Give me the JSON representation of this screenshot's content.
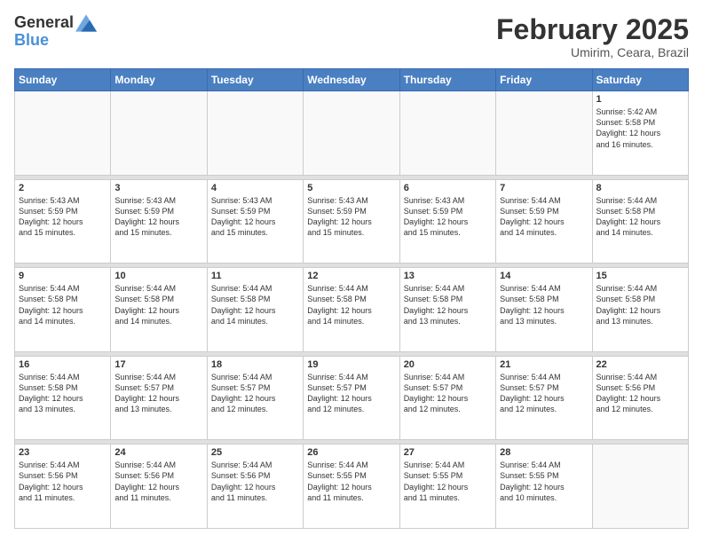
{
  "header": {
    "logo": {
      "text_general": "General",
      "text_blue": "Blue"
    },
    "title": "February 2025",
    "subtitle": "Umirim, Ceara, Brazil"
  },
  "days_of_week": [
    "Sunday",
    "Monday",
    "Tuesday",
    "Wednesday",
    "Thursday",
    "Friday",
    "Saturday"
  ],
  "weeks": [
    [
      {
        "day": "",
        "info": ""
      },
      {
        "day": "",
        "info": ""
      },
      {
        "day": "",
        "info": ""
      },
      {
        "day": "",
        "info": ""
      },
      {
        "day": "",
        "info": ""
      },
      {
        "day": "",
        "info": ""
      },
      {
        "day": "1",
        "info": "Sunrise: 5:42 AM\nSunset: 5:58 PM\nDaylight: 12 hours\nand 16 minutes."
      }
    ],
    [
      {
        "day": "2",
        "info": "Sunrise: 5:43 AM\nSunset: 5:59 PM\nDaylight: 12 hours\nand 15 minutes."
      },
      {
        "day": "3",
        "info": "Sunrise: 5:43 AM\nSunset: 5:59 PM\nDaylight: 12 hours\nand 15 minutes."
      },
      {
        "day": "4",
        "info": "Sunrise: 5:43 AM\nSunset: 5:59 PM\nDaylight: 12 hours\nand 15 minutes."
      },
      {
        "day": "5",
        "info": "Sunrise: 5:43 AM\nSunset: 5:59 PM\nDaylight: 12 hours\nand 15 minutes."
      },
      {
        "day": "6",
        "info": "Sunrise: 5:43 AM\nSunset: 5:59 PM\nDaylight: 12 hours\nand 15 minutes."
      },
      {
        "day": "7",
        "info": "Sunrise: 5:44 AM\nSunset: 5:59 PM\nDaylight: 12 hours\nand 14 minutes."
      },
      {
        "day": "8",
        "info": "Sunrise: 5:44 AM\nSunset: 5:58 PM\nDaylight: 12 hours\nand 14 minutes."
      }
    ],
    [
      {
        "day": "9",
        "info": "Sunrise: 5:44 AM\nSunset: 5:58 PM\nDaylight: 12 hours\nand 14 minutes."
      },
      {
        "day": "10",
        "info": "Sunrise: 5:44 AM\nSunset: 5:58 PM\nDaylight: 12 hours\nand 14 minutes."
      },
      {
        "day": "11",
        "info": "Sunrise: 5:44 AM\nSunset: 5:58 PM\nDaylight: 12 hours\nand 14 minutes."
      },
      {
        "day": "12",
        "info": "Sunrise: 5:44 AM\nSunset: 5:58 PM\nDaylight: 12 hours\nand 14 minutes."
      },
      {
        "day": "13",
        "info": "Sunrise: 5:44 AM\nSunset: 5:58 PM\nDaylight: 12 hours\nand 13 minutes."
      },
      {
        "day": "14",
        "info": "Sunrise: 5:44 AM\nSunset: 5:58 PM\nDaylight: 12 hours\nand 13 minutes."
      },
      {
        "day": "15",
        "info": "Sunrise: 5:44 AM\nSunset: 5:58 PM\nDaylight: 12 hours\nand 13 minutes."
      }
    ],
    [
      {
        "day": "16",
        "info": "Sunrise: 5:44 AM\nSunset: 5:58 PM\nDaylight: 12 hours\nand 13 minutes."
      },
      {
        "day": "17",
        "info": "Sunrise: 5:44 AM\nSunset: 5:57 PM\nDaylight: 12 hours\nand 13 minutes."
      },
      {
        "day": "18",
        "info": "Sunrise: 5:44 AM\nSunset: 5:57 PM\nDaylight: 12 hours\nand 12 minutes."
      },
      {
        "day": "19",
        "info": "Sunrise: 5:44 AM\nSunset: 5:57 PM\nDaylight: 12 hours\nand 12 minutes."
      },
      {
        "day": "20",
        "info": "Sunrise: 5:44 AM\nSunset: 5:57 PM\nDaylight: 12 hours\nand 12 minutes."
      },
      {
        "day": "21",
        "info": "Sunrise: 5:44 AM\nSunset: 5:57 PM\nDaylight: 12 hours\nand 12 minutes."
      },
      {
        "day": "22",
        "info": "Sunrise: 5:44 AM\nSunset: 5:56 PM\nDaylight: 12 hours\nand 12 minutes."
      }
    ],
    [
      {
        "day": "23",
        "info": "Sunrise: 5:44 AM\nSunset: 5:56 PM\nDaylight: 12 hours\nand 11 minutes."
      },
      {
        "day": "24",
        "info": "Sunrise: 5:44 AM\nSunset: 5:56 PM\nDaylight: 12 hours\nand 11 minutes."
      },
      {
        "day": "25",
        "info": "Sunrise: 5:44 AM\nSunset: 5:56 PM\nDaylight: 12 hours\nand 11 minutes."
      },
      {
        "day": "26",
        "info": "Sunrise: 5:44 AM\nSunset: 5:55 PM\nDaylight: 12 hours\nand 11 minutes."
      },
      {
        "day": "27",
        "info": "Sunrise: 5:44 AM\nSunset: 5:55 PM\nDaylight: 12 hours\nand 11 minutes."
      },
      {
        "day": "28",
        "info": "Sunrise: 5:44 AM\nSunset: 5:55 PM\nDaylight: 12 hours\nand 10 minutes."
      },
      {
        "day": "",
        "info": ""
      }
    ]
  ]
}
